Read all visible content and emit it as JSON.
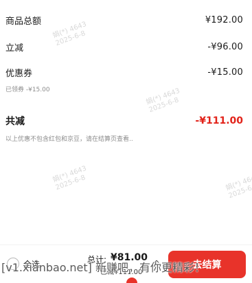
{
  "watermarks": [
    "娟(*) 4643\n2025-6-8",
    "娟(*) 4643\n2025-6-8",
    "娟(*) 4643\n2025-6-8",
    "娟(*) 4643\n2025-6-8"
  ],
  "summary": {
    "goods_total_label": "商品总额",
    "goods_total_value": "¥192.00",
    "instant_discount_label": "立减",
    "instant_discount_value": "-¥96.00",
    "coupon_label": "优惠券",
    "coupon_value": "-¥15.00",
    "coupon_note": "已领券 -¥15.00",
    "total_reduction_label": "共减",
    "total_reduction_value": "-¥111.00",
    "total_note": "以上优惠不包含红包和京豆，请在结算页查看.."
  },
  "bottom_bar": {
    "select_all_label": "全选",
    "sum_label": "总计:",
    "sum_value": "¥81.00",
    "reduced_text": "已减¥111.00",
    "checkout_label": "去结算"
  },
  "overlay_text": "[v1.xianbao.net] 新赚吧，有你更精彩！",
  "colors": {
    "accent": "#e8332a",
    "discount_red": "#e2231a"
  },
  "icons": {
    "select_all": "circle-checkbox-icon",
    "expand": "chevron-up-icon"
  }
}
